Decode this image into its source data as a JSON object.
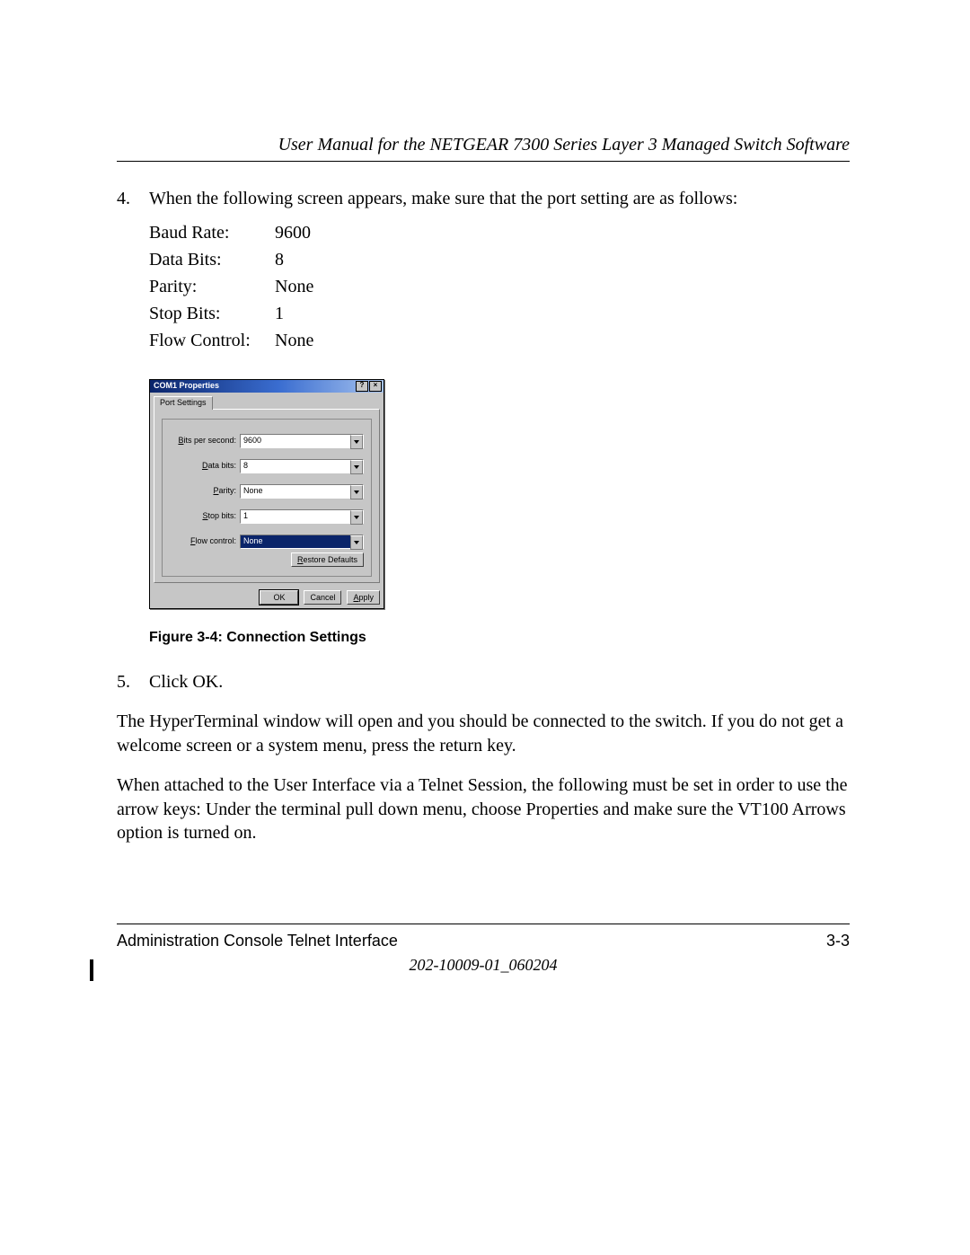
{
  "header": {
    "title": "User Manual for the NETGEAR 7300 Series Layer 3 Managed Switch Software"
  },
  "step4": {
    "number": "4.",
    "text": "When the following screen appears, make sure that the port setting are as follows:",
    "settings": [
      {
        "label": "Baud Rate:",
        "value": "9600"
      },
      {
        "label": "Data Bits:",
        "value": "8"
      },
      {
        "label": "Parity:",
        "value": "None"
      },
      {
        "label": "Stop Bits:",
        "value": "1"
      },
      {
        "label": "Flow Control:",
        "value": "None"
      }
    ]
  },
  "dialog": {
    "title": "COM1 Properties",
    "help_btn": "?",
    "close_btn": "×",
    "tab": "Port Settings",
    "fields": {
      "bps": {
        "label_pre": "B",
        "label_rest": "its per second:",
        "value": "9600"
      },
      "databits": {
        "label_pre": "D",
        "label_rest": "ata bits:",
        "value": "8"
      },
      "parity": {
        "label_pre": "P",
        "label_rest": "arity:",
        "value": "None"
      },
      "stopbits": {
        "label_pre": "S",
        "label_rest": "top bits:",
        "value": "1"
      },
      "flow": {
        "label_pre": "F",
        "label_rest": "low control:",
        "value": "None"
      }
    },
    "restore_pre": "R",
    "restore_rest": "estore Defaults",
    "ok": "OK",
    "cancel": "Cancel",
    "apply_pre": "A",
    "apply_rest": "pply"
  },
  "figure_caption": "Figure 3-4:  Connection Settings",
  "step5": {
    "number": "5.",
    "text": "Click OK."
  },
  "para1": "The HyperTerminal window will open and you should be connected to the switch. If you do not get a welcome screen or a system menu, press the return key.",
  "para2": "When attached to the User Interface via a Telnet Session, the following must be set in order to use the arrow keys: Under the terminal pull down menu, choose Properties and make sure the VT100 Arrows option is turned on.",
  "footer": {
    "left": "Administration Console Telnet Interface",
    "right": "3-3",
    "docnum": "202-10009-01_060204"
  }
}
